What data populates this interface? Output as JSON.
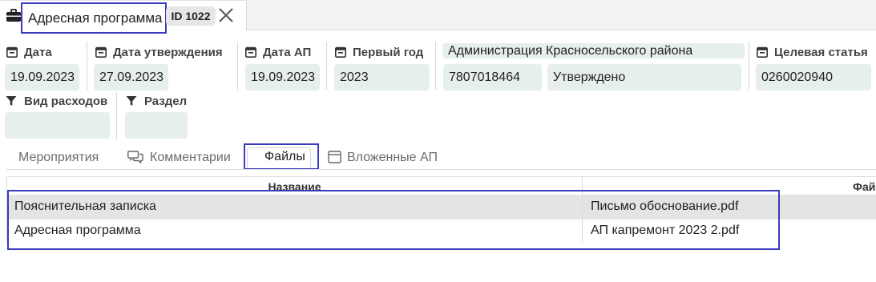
{
  "window_tab": {
    "title": "Адресная программа",
    "id_badge": "ID 1022"
  },
  "fields": {
    "date": {
      "label": "Дата",
      "value": "19.09.2023"
    },
    "approval_date": {
      "label": "Дата утверждения",
      "value": "27.09.2023"
    },
    "ap_date": {
      "label": "Дата АП",
      "value": "19.09.2023"
    },
    "first_year": {
      "label": "Первый год",
      "value": "2023"
    },
    "organization": {
      "name": "Администрация Красносельского района",
      "inn": "7807018464",
      "status": "Утверждено"
    },
    "target_article": {
      "label": "Целевая статья",
      "value": "0260020940"
    },
    "expense_type": {
      "label": "Вид расходов",
      "value": ""
    },
    "section": {
      "label": "Раздел",
      "value": ""
    }
  },
  "subtabs": [
    {
      "label": "Мероприятия"
    },
    {
      "label": "Комментарии"
    },
    {
      "label": "Файлы"
    },
    {
      "label": "Вложенные АП"
    }
  ],
  "table": {
    "columns": [
      "Название",
      "Фай"
    ],
    "rows": [
      {
        "name": "Пояснительная записка",
        "file": "Письмо обоснование.pdf"
      },
      {
        "name": "Адресная программа",
        "file": "АП капремонт 2023 2.pdf"
      }
    ]
  },
  "colors": {
    "accent_highlight": "#3b3bbf",
    "field_bg": "#e6eeee",
    "selected_row": "#e4e4e4"
  }
}
